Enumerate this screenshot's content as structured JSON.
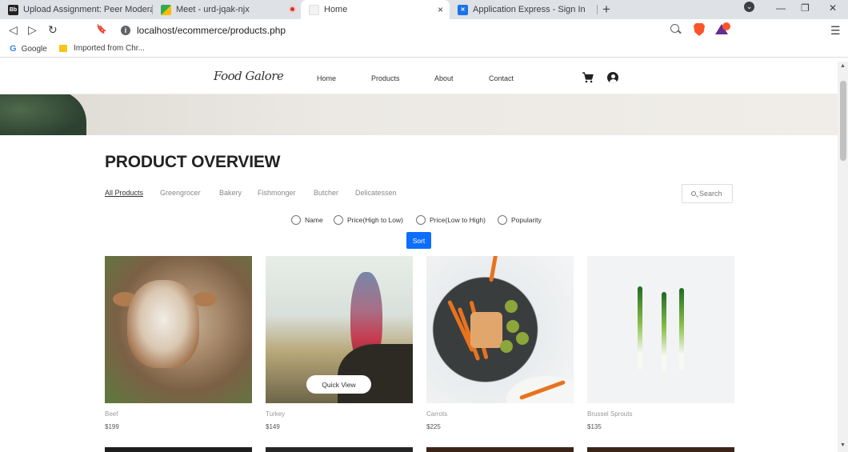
{
  "browser": {
    "tabs": [
      {
        "label": "Upload Assignment: Peer Moderation",
        "icon": "blackboard-icon"
      },
      {
        "label": "Meet - urd-jqak-njx",
        "icon": "meet-icon"
      },
      {
        "label": "Home",
        "icon": "page-icon",
        "close": "×"
      },
      {
        "label": "Application Express - Sign In",
        "icon": "apex-icon"
      }
    ],
    "new_tab": "+",
    "url": "localhost/ecommerce/products.php",
    "bookmarks": [
      {
        "label": "Google",
        "icon": "google-icon"
      },
      {
        "label": "Imported from Chr...",
        "icon": "folder-icon"
      }
    ],
    "window_controls": [
      "⌄",
      "—",
      "❐",
      "✕"
    ],
    "nav": [
      "◁",
      "▷",
      "↻",
      "🔖"
    ],
    "menu": "☰"
  },
  "site": {
    "logo": "Food Galore",
    "menu": [
      "Home",
      "Products",
      "About",
      "Contact"
    ]
  },
  "page": {
    "heading": "PRODUCT OVERVIEW",
    "filters": [
      "All Products",
      "Greengrocer",
      "Bakery",
      "Fishmonger",
      "Butcher",
      "Delicatessen"
    ],
    "active_filter": "All Products",
    "search_label": "Search",
    "sort_options": [
      "Name",
      "Price(High to Low)",
      "Price(Low to High)",
      "Popularity"
    ],
    "sort_button": "Sort",
    "quick_view": "Quick View",
    "products": [
      {
        "name": "Beef",
        "price": "$199"
      },
      {
        "name": "Turkey",
        "price": "$149"
      },
      {
        "name": "Carrots",
        "price": "$225"
      },
      {
        "name": "Brussel Sprouts",
        "price": "$135"
      }
    ]
  },
  "colors": {
    "sort_button": "#0d6efd",
    "tab_bar": "#dee1e6",
    "brave": "#fb542b"
  }
}
